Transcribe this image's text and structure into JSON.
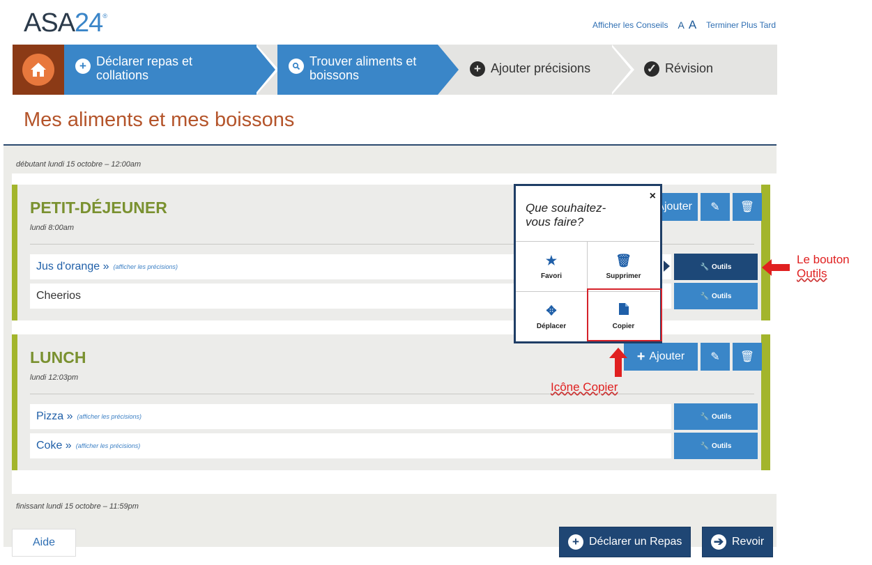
{
  "header": {
    "logo_text": "ASA",
    "logo_num": "24",
    "logo_mark": "®",
    "tips_link": "Afficher les Conseils",
    "font_small": "A",
    "font_large": "A",
    "finish_later": "Terminer Plus Tard"
  },
  "steps": {
    "step1": "Déclarer repas et collations",
    "step2": "Trouver aliments et boissons",
    "step3": "Ajouter précisions",
    "step4": "Révision"
  },
  "page_title": "Mes aliments et mes boissons",
  "range": {
    "start": "débutant lundi 15 octobre – 12:00am",
    "end": "finissant lundi 15 octobre – 11:59pm"
  },
  "meals": [
    {
      "name": "PETIT-DÉJEUNER",
      "time": "lundi 8:00am",
      "add_label": "Ajouter",
      "foods": [
        {
          "name": "Jus d'orange »",
          "more": "(afficher les précisions)"
        },
        {
          "name": "Cheerios",
          "more": ""
        }
      ]
    },
    {
      "name": "LUNCH",
      "time": "lundi 12:03pm",
      "add_label": "Ajouter",
      "foods": [
        {
          "name": "Pizza »",
          "more": "(afficher les précisions)"
        },
        {
          "name": "Coke »",
          "more": "(afficher les précisions)"
        }
      ]
    }
  ],
  "tools_label": "Outils",
  "popup": {
    "title": "Que souhaitez-vous faire?",
    "close": "×",
    "favorite": "Favori",
    "delete": "Supprimer",
    "move": "Déplacer",
    "copy": "Copier"
  },
  "annotations": {
    "tools_line1": "Le bouton",
    "tools_line2": "Outils",
    "copy_icon": "Icône Copier"
  },
  "bottom": {
    "help": "Aide",
    "declare_meal": "Déclarer un Repas",
    "review": "Revoir"
  },
  "colors": {
    "brand_blue": "#3a86c8",
    "dark_blue": "#1f4674",
    "meal_green": "#a3b52c",
    "title_orange": "#b4542a",
    "annotation_red": "#e02020"
  },
  "icons": [
    "home-icon",
    "plus-icon",
    "search-icon",
    "check-icon",
    "pencil-icon",
    "trash-icon",
    "wrench-icon",
    "star-icon",
    "move-icon",
    "copy-icon",
    "arrow-right-icon"
  ]
}
